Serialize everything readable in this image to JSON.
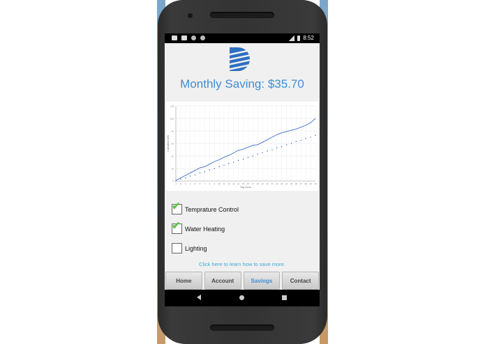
{
  "status_bar": {
    "time": "8:52"
  },
  "header": {
    "title": "Monthly Saving: $35.70"
  },
  "brand": {
    "accent": "#3d8ed6"
  },
  "options": [
    {
      "label": "Temprature Control",
      "checked": true
    },
    {
      "label": "Water Heating",
      "checked": true
    },
    {
      "label": "Lighting",
      "checked": false
    }
  ],
  "learn_more": "Click here to learn how to save more.",
  "nav": {
    "home": "Home",
    "account": "Account",
    "savings": "Savings",
    "contact": "Contact",
    "active": "Savings"
  },
  "chart_data": {
    "type": "line",
    "xlabel": "Day Count",
    "ylabel": "Cumulative kWh",
    "x": [
      1,
      2,
      3,
      4,
      5,
      6,
      7,
      8,
      9,
      10,
      11,
      12,
      13,
      14,
      15,
      16,
      17,
      18,
      19,
      20,
      21,
      22,
      23,
      24,
      25,
      26,
      27,
      28,
      29,
      30
    ],
    "xlim": [
      1,
      30
    ],
    "ylim": [
      0,
      120
    ],
    "yticks": [
      0,
      20,
      40,
      60,
      80,
      100,
      120
    ],
    "grid": true,
    "series": [
      {
        "style": "solid",
        "color": "#3a6fc4",
        "values": [
          1,
          5,
          9,
          13,
          17,
          21,
          23,
          27,
          31,
          34,
          38,
          41,
          45,
          49,
          51,
          54,
          57,
          58,
          62,
          66,
          70,
          74,
          77,
          79,
          81,
          83,
          86,
          89,
          93,
          100
        ]
      },
      {
        "style": "dotted",
        "color": "#3a6fc4",
        "values": [
          0,
          3,
          5,
          8,
          10,
          13,
          15,
          18,
          20,
          23,
          25,
          28,
          30,
          33,
          35,
          38,
          40,
          43,
          45,
          48,
          50,
          53,
          55,
          58,
          60,
          63,
          65,
          68,
          70,
          73
        ]
      }
    ]
  }
}
